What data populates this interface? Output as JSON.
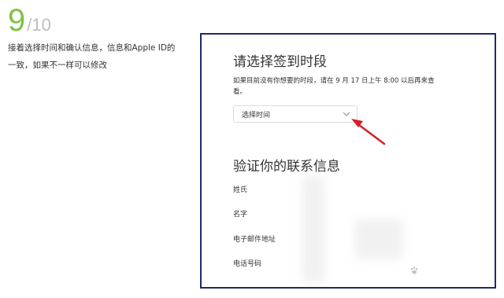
{
  "step": {
    "current": "9",
    "total": "/10",
    "description": "接着选择时间和确认信息，信息和Apple ID的一致，如果不一样可以修改"
  },
  "screenshot": {
    "section_select": {
      "title": "请选择签到时段",
      "description": "如果目前没有你想要的时段，请在 9 月 17 日上午 8:00 以后再来查看。",
      "dropdown": {
        "value": "选择时间",
        "icon": "chevron-down-icon"
      }
    },
    "section_verify": {
      "title": "验证你的联系信息",
      "fields": [
        {
          "label": "姓氏"
        },
        {
          "label": "名字"
        },
        {
          "label": "电子邮件地址"
        },
        {
          "label": "电话号码"
        }
      ]
    },
    "annotation_color": "#d0202a",
    "border_color": "#1f2a6b"
  },
  "colors": {
    "step_accent": "#7cc242"
  }
}
